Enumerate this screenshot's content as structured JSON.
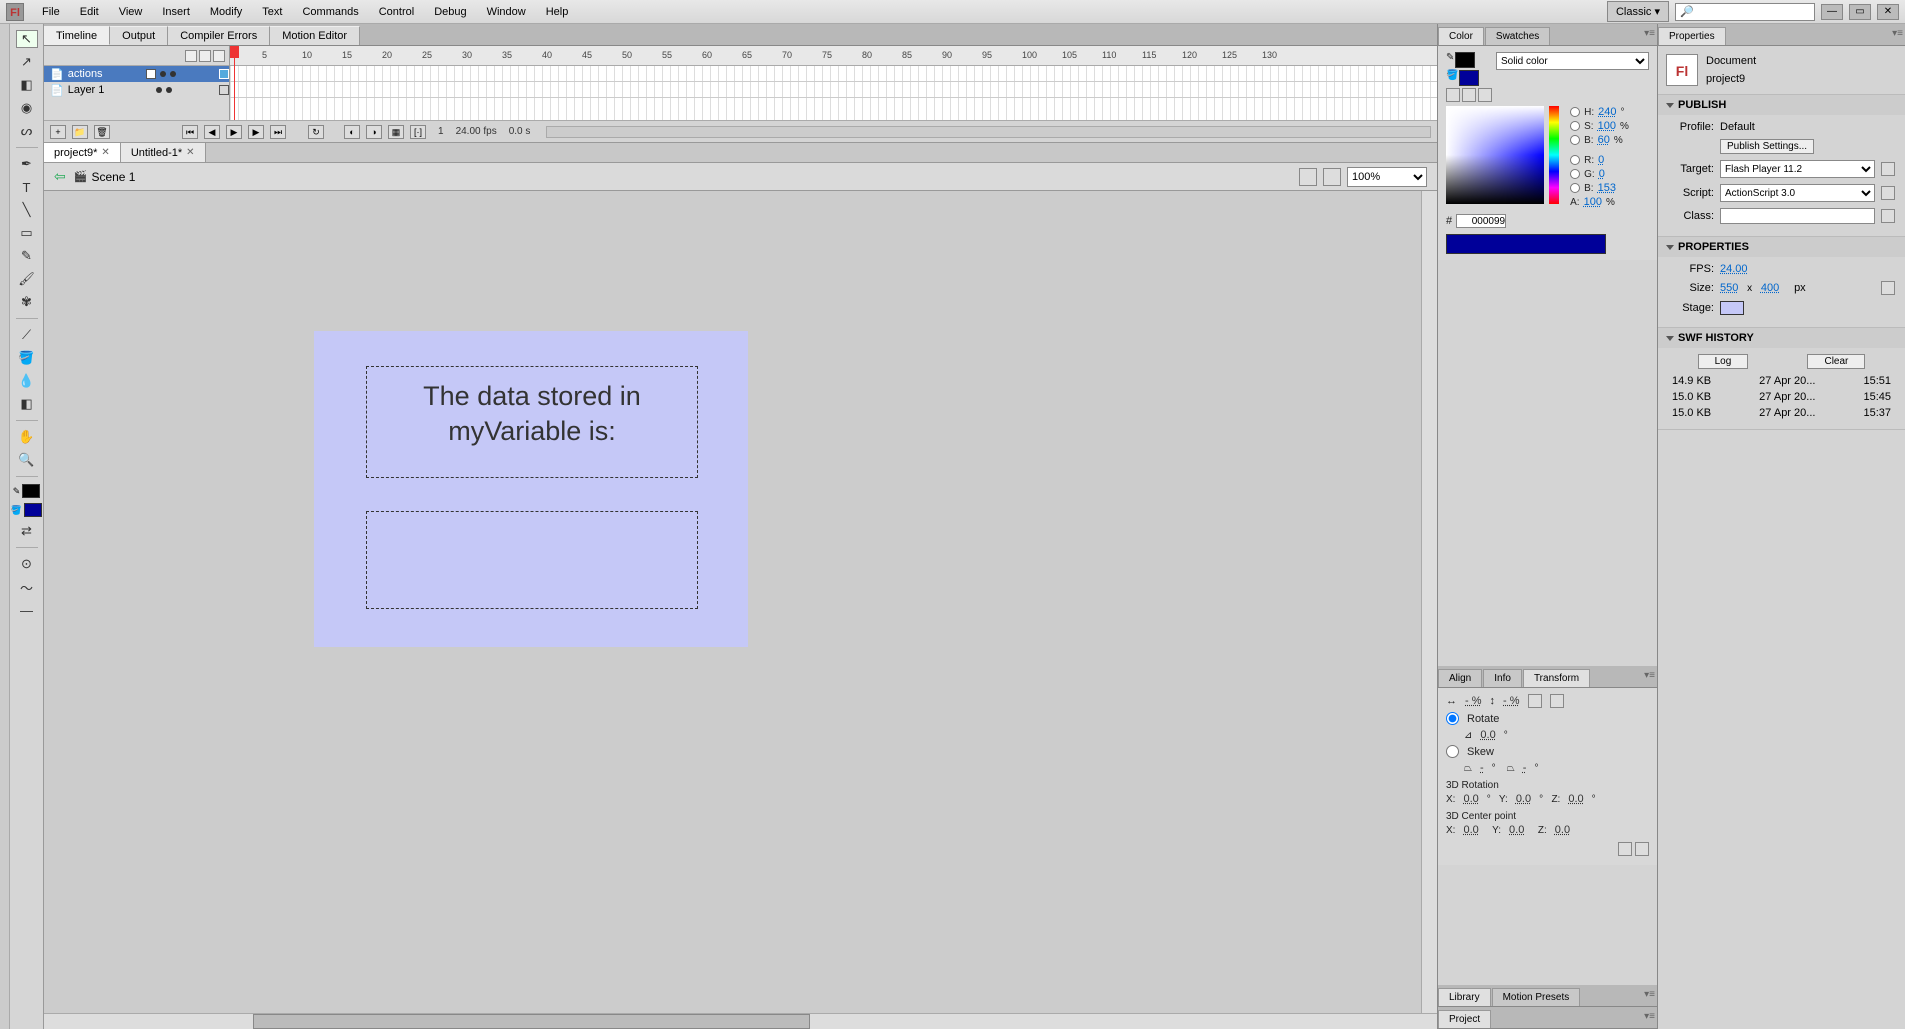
{
  "menubar": {
    "logo": "Fl",
    "items": [
      "File",
      "Edit",
      "View",
      "Insert",
      "Modify",
      "Text",
      "Commands",
      "Control",
      "Debug",
      "Window",
      "Help"
    ],
    "workspace_label": "Classic  ▾",
    "search_placeholder": "🔎"
  },
  "center_tabs": [
    "Timeline",
    "Output",
    "Compiler Errors",
    "Motion Editor"
  ],
  "timeline": {
    "layers": [
      {
        "name": "actions",
        "selected": true
      },
      {
        "name": "Layer 1",
        "selected": false
      }
    ],
    "ruler_marks": [
      1,
      5,
      10,
      15,
      20,
      25,
      30,
      35,
      40,
      45,
      50,
      55,
      60,
      65,
      70,
      75,
      80,
      85,
      90,
      95,
      100,
      105,
      110,
      115,
      120,
      125,
      130
    ],
    "status": {
      "frame": "1",
      "fps": "24.00 fps",
      "time": "0.0 s"
    }
  },
  "doc_tabs": [
    {
      "name": "project9*",
      "active": true
    },
    {
      "name": "Untitled-1*",
      "active": false
    }
  ],
  "scene": {
    "name": "Scene 1",
    "zoom": "100%"
  },
  "stage": {
    "text1": "The data stored in myVariable is:",
    "text2": ""
  },
  "color_panel": {
    "tabs": [
      "Color",
      "Swatches"
    ],
    "type": "Solid color",
    "h": "240",
    "s": "100",
    "b": "60",
    "r": "0",
    "g": "0",
    "bl": "153",
    "hex": "000099",
    "a": "100"
  },
  "transform_panel": {
    "tabs": [
      "Align",
      "Info",
      "Transform"
    ],
    "rotate": "0.0",
    "skew": "-",
    "x": "0.0",
    "y": "0.0",
    "z": "0.0",
    "cx": "0.0",
    "cy": "0.0",
    "cz": "0.0",
    "labels": {
      "rotate": "Rotate",
      "skew": "Skew",
      "3drot": "3D Rotation",
      "3dcen": "3D Center point"
    },
    "wpct": "- %",
    "hpct": "- %"
  },
  "library_tabs": [
    "Library",
    "Motion Presets"
  ],
  "project_tab": "Project",
  "properties": {
    "tab": "Properties",
    "doc_label": "Document",
    "doc_name": "project9",
    "publish": {
      "head": "PUBLISH",
      "profile_label": "Profile:",
      "profile": "Default",
      "settings_btn": "Publish Settings...",
      "target_label": "Target:",
      "target": "Flash Player 11.2",
      "script_label": "Script:",
      "script": "ActionScript 3.0",
      "class_label": "Class:",
      "class": ""
    },
    "props": {
      "head": "PROPERTIES",
      "fps_label": "FPS:",
      "fps": "24.00",
      "size_label": "Size:",
      "w": "550",
      "h": "400",
      "px": "px",
      "stage_label": "Stage:"
    },
    "swf": {
      "head": "SWF HISTORY",
      "log_btn": "Log",
      "clear_btn": "Clear",
      "rows": [
        {
          "size": "14.9 KB",
          "date": "27 Apr 20...",
          "time": "15:51"
        },
        {
          "size": "15.0 KB",
          "date": "27 Apr 20...",
          "time": "15:45"
        },
        {
          "size": "15.0 KB",
          "date": "27 Apr 20...",
          "time": "15:37"
        }
      ]
    }
  }
}
